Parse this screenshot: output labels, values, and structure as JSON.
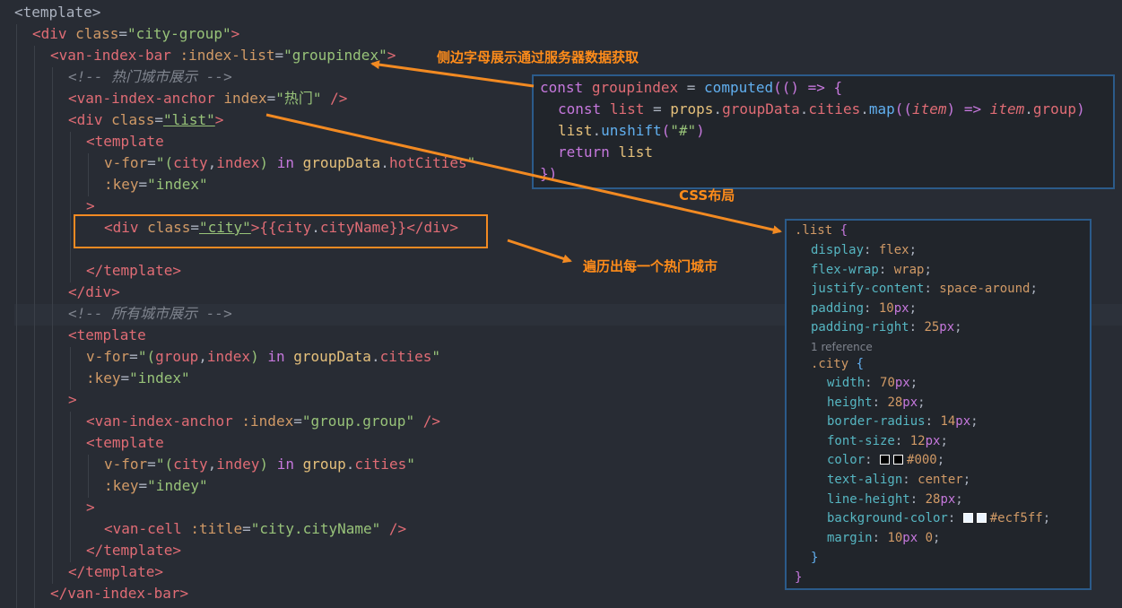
{
  "code": {
    "l1": "<template>",
    "l2_open": "<div",
    "l2_attr": "class",
    "l2_val": "\"city-group\"",
    "l2_close": ">",
    "l3_open": "<van-index-bar",
    "l3_attr": ":index-list",
    "l3_val": "\"groupindex\"",
    "l3_close": ">",
    "l4": "<!-- 热门城市展示 -->",
    "l5_open": "<van-index-anchor",
    "l5_attr": "index",
    "l5_val": "\"热门\"",
    "l5_close": " />",
    "l6_open": "<div",
    "l6_attr": "class",
    "l6_val": "\"list\"",
    "l6_close": ">",
    "l7": "<template",
    "l8_attr": "v-for",
    "l8_q1": "\"(",
    "l8_city": "city",
    "l8_comma": ",",
    "l8_index": "index",
    "l8_q2": ") ",
    "l8_in": "in",
    "l8_obj": "groupData",
    "l8_dot": ".",
    "l8_prop": "hotCities",
    "l8_q3": "\"",
    "l9_attr": ":key",
    "l9_val": "\"index\"",
    "l10": ">",
    "l11_open": "<div",
    "l11_attr": "class",
    "l11_val": "\"city\"",
    "l11_mid": ">{{",
    "l11_v1": "city",
    "l11_dot": ".",
    "l11_v2": "cityName",
    "l11_end1": "}}</",
    "l11_tag": "div",
    "l11_end2": ">",
    "l13": "</template>",
    "l14": "</div>",
    "l15": "<!-- 所有城市展示 -->",
    "l16": "<template",
    "l17_attr": "v-for",
    "l17_q1": "\"(",
    "l17_group": "group",
    "l17_comma": ",",
    "l17_index": "index",
    "l17_q2": ") ",
    "l17_in": "in",
    "l17_obj": "groupData",
    "l17_dot": ".",
    "l17_prop": "cities",
    "l17_q3": "\"",
    "l18_attr": ":key",
    "l18_val": "\"index\"",
    "l19": ">",
    "l20_open": "<van-index-anchor",
    "l20_attr": ":index",
    "l20_val": "\"group.group\"",
    "l20_close": " />",
    "l21": "<template",
    "l22_attr": "v-for",
    "l22_q1": "\"(",
    "l22_city": "city",
    "l22_comma": ",",
    "l22_index": "indey",
    "l22_q2": ") ",
    "l22_in": "in",
    "l22_obj": "group",
    "l22_dot": ".",
    "l22_prop": "cities",
    "l22_q3": "\"",
    "l23_attr": ":key",
    "l23_val": "\"indey\"",
    "l24": ">",
    "l25_open": "<van-cell",
    "l25_attr": ":title",
    "l25_val": "\"city.cityName\"",
    "l25_close": " />",
    "l26": "</template>",
    "l27": "</template>",
    "l28": "</van-index-bar>"
  },
  "computed_panel": {
    "line1": {
      "kw": "const",
      "name": "groupindex",
      "eq": " = ",
      "fn": "computed",
      "rest": "(() => {"
    },
    "line2": {
      "kw": "const",
      "name": "list",
      "eq": " = ",
      "obj": "props",
      "p1": "groupData",
      "p2": "cities",
      "fn": "map",
      "arg": "item",
      "arrow": " => ",
      "arg2": "item",
      "p3": "group",
      "end": ")"
    },
    "line3": {
      "obj": "list",
      "fn": "unshift",
      "str": "\"#\"",
      "end": ")"
    },
    "line4": {
      "kw": "return",
      "name": "list"
    },
    "line5": "})"
  },
  "css_panel": {
    "selector": ".list",
    "brace_open": " {",
    "rules": [
      {
        "prop": "display",
        "val": "flex"
      },
      {
        "prop": "flex-wrap",
        "val": "wrap"
      },
      {
        "prop": "justify-content",
        "val": "space-around"
      },
      {
        "prop": "padding",
        "num": "10",
        "unit": "px"
      },
      {
        "prop": "padding-right",
        "num": "25",
        "unit": "px"
      }
    ],
    "codelens": "1 reference",
    "nested_selector": ".city",
    "nested_rules": [
      {
        "prop": "width",
        "num": "70",
        "unit": "px"
      },
      {
        "prop": "height",
        "num": "28",
        "unit": "px"
      },
      {
        "prop": "border-radius",
        "num": "14",
        "unit": "px"
      },
      {
        "prop": "font-size",
        "num": "12",
        "unit": "px"
      },
      {
        "prop": "color",
        "val": "#000",
        "swatch": "#000000"
      },
      {
        "prop": "text-align",
        "val": "center"
      },
      {
        "prop": "line-height",
        "num": "28",
        "unit": "px"
      },
      {
        "prop": "background-color",
        "val": "#ecf5ff",
        "swatch": "#ecf5ff"
      },
      {
        "prop": "margin",
        "num": "10",
        "unit": "px",
        "extra": "0"
      }
    ],
    "nested_close": "}",
    "close": "}"
  },
  "annotations": {
    "index_list": "侧边字母展示通过服务器数据获取",
    "css_layout": "CSS布局",
    "loop_hot": "遍历出每一个热门城市"
  },
  "colors": {
    "annotation": "#ff8c1a",
    "panel_border": "#2b5b8a",
    "background": "#282c34"
  }
}
